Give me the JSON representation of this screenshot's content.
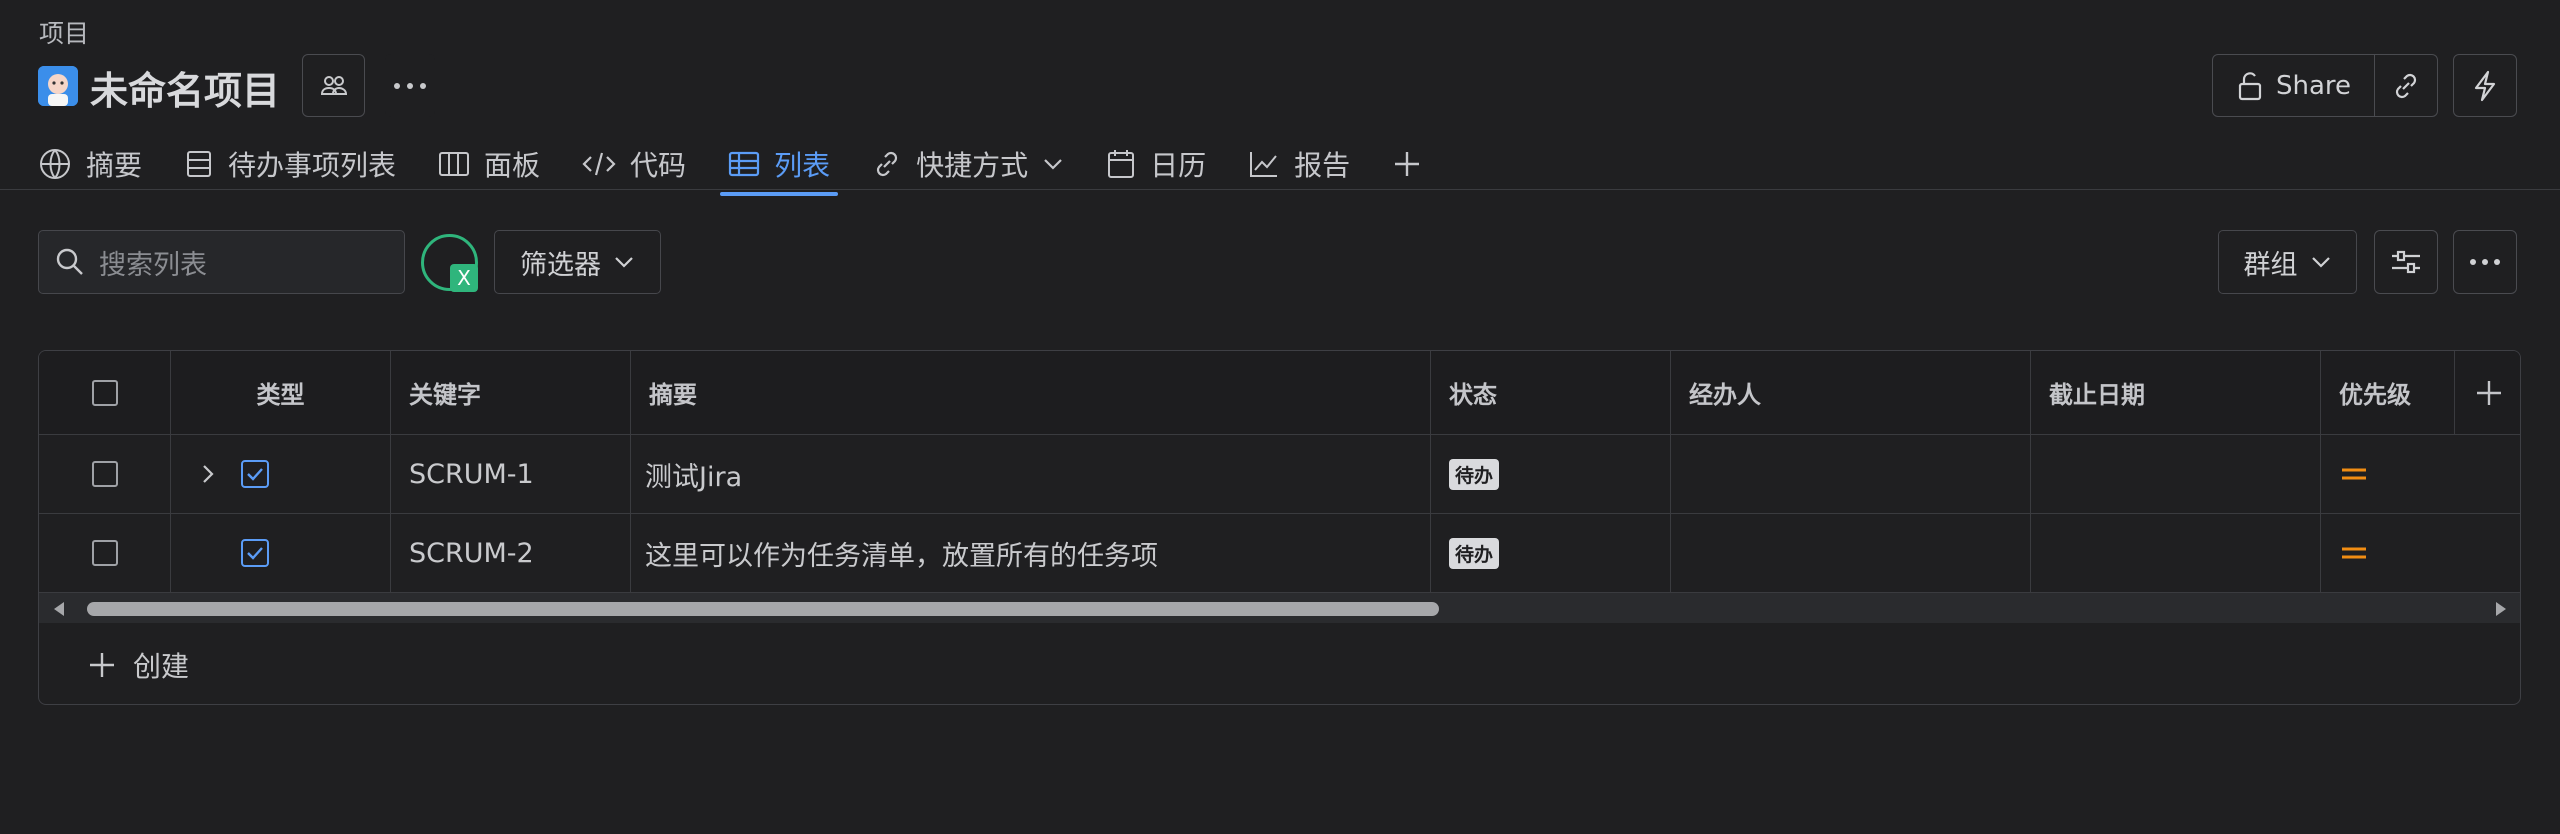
{
  "breadcrumb": "项目",
  "project": {
    "title": "未命名项目"
  },
  "header": {
    "share_label": "Share"
  },
  "tabs": [
    {
      "label": "摘要",
      "icon": "globe-icon"
    },
    {
      "label": "待办事项列表",
      "icon": "backlog-icon"
    },
    {
      "label": "面板",
      "icon": "board-icon"
    },
    {
      "label": "代码",
      "icon": "code-icon"
    },
    {
      "label": "列表",
      "icon": "list-table-icon",
      "active": true
    },
    {
      "label": "快捷方式",
      "icon": "link-icon"
    },
    {
      "label": "日历",
      "icon": "calendar-icon"
    },
    {
      "label": "报告",
      "icon": "chart-line-icon"
    }
  ],
  "toolbar": {
    "search_placeholder": "搜索列表",
    "avatar_badge": "X",
    "filter_label": "筛选器",
    "group_label": "群组"
  },
  "table": {
    "columns": [
      "类型",
      "关键字",
      "摘要",
      "状态",
      "经办人",
      "截止日期",
      "优先级"
    ],
    "rows": [
      {
        "key": "SCRUM-1",
        "summary": "测试Jira",
        "status": "待办",
        "assignee": "",
        "due": "",
        "priority": "medium",
        "expandable": true
      },
      {
        "key": "SCRUM-2",
        "summary": "这里可以作为任务清单，放置所有的任务项",
        "status": "待办",
        "assignee": "",
        "due": "",
        "priority": "medium",
        "expandable": false
      }
    ],
    "create_label": "创建"
  },
  "colors": {
    "accent": "#5b9cf6",
    "priority_medium": "#f18d13",
    "avatar_ring": "#2fb57c"
  }
}
